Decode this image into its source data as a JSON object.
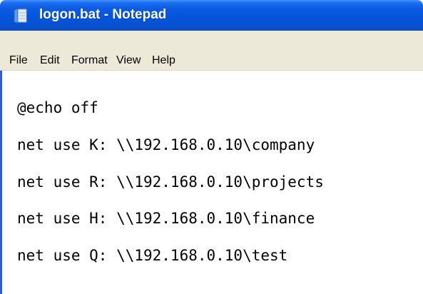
{
  "window": {
    "title": "logon.bat - Notepad",
    "title_icon": "notepad-icon"
  },
  "menu": {
    "items": [
      "File",
      "Edit",
      "Format",
      "View",
      "Help"
    ]
  },
  "editor": {
    "lines": [
      "@echo off",
      "net use K: \\\\192.168.0.10\\company",
      "net use R: \\\\192.168.0.10\\projects",
      "net use H: \\\\192.168.0.10\\finance",
      "net use Q: \\\\192.168.0.10\\test"
    ]
  },
  "colors": {
    "titlebar": "#0655da",
    "menubar": "#ece9d8",
    "editor_background": "#ffffff",
    "text": "#000000"
  }
}
